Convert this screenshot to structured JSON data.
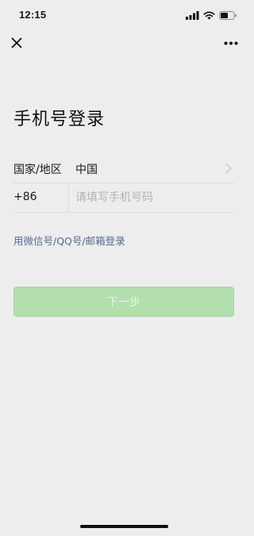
{
  "status_bar": {
    "time": "12:15",
    "icons": [
      "signal-icon",
      "wifi-icon",
      "battery-icon"
    ]
  },
  "top_bar": {
    "close_icon": "close-icon",
    "more_icon": "more-icon"
  },
  "page": {
    "title": "手机号登录"
  },
  "form": {
    "region_label": "国家/地区",
    "region_value": "中国",
    "country_code": "+86",
    "phone_value": "",
    "phone_placeholder": "请填写手机号码"
  },
  "links": {
    "alt_login": "用微信号/QQ号/邮箱登录"
  },
  "actions": {
    "next_label": "下一步"
  },
  "colors": {
    "background": "#ededed",
    "link": "#576b95",
    "button_disabled_bg": "#b2dfad",
    "button_disabled_text": "#e8f6e6",
    "placeholder": "#b2b2b2"
  }
}
